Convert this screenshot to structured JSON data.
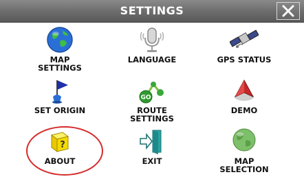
{
  "window": {
    "title": "SETTINGS"
  },
  "menu": {
    "items": [
      {
        "label": "MAP\nSETTINGS",
        "icon": "globe-icon"
      },
      {
        "label": "LANGUAGE",
        "icon": "microphone-icon"
      },
      {
        "label": "GPS STATUS",
        "icon": "satellite-icon"
      },
      {
        "label": "SET ORIGIN",
        "icon": "flag-icon"
      },
      {
        "label": "ROUTE\nSETTINGS",
        "icon": "route-nodes-icon"
      },
      {
        "label": "DEMO",
        "icon": "navigation-arrow-icon"
      },
      {
        "label": "ABOUT",
        "icon": "question-cube-icon"
      },
      {
        "label": "EXIT",
        "icon": "exit-door-icon"
      },
      {
        "label": "MAP\nSELECTION",
        "icon": "map-globe-icon"
      }
    ]
  },
  "colors": {
    "titlebar": "#6e6e6e",
    "highlight": "#d62a2a"
  }
}
